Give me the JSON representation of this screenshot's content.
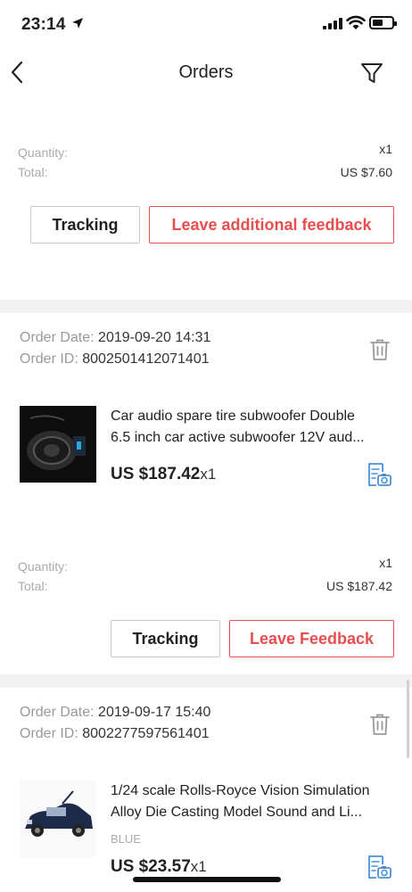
{
  "status": {
    "time": "23:14"
  },
  "nav": {
    "title": "Orders"
  },
  "order0": {
    "quantity_label": "Quantity:",
    "quantity_value": "x1",
    "total_label": "Total:",
    "total_value": "US $7.60",
    "tracking_label": "Tracking",
    "feedback_label": "Leave additional feedback"
  },
  "order1": {
    "date_label": "Order Date:",
    "date_value": "2019-09-20 14:31",
    "id_label": "Order ID:",
    "id_value": "8002501412071401",
    "title_line1": "Car audio spare tire subwoofer Double",
    "title_line2": "6.5 inch car active subwoofer 12V aud...",
    "price": "US $187.42",
    "qty": "x1",
    "quantity_label": "Quantity:",
    "quantity_value": "x1",
    "total_label": "Total:",
    "total_value": "US $187.42",
    "tracking_label": "Tracking",
    "feedback_label": "Leave Feedback"
  },
  "order2": {
    "date_label": "Order Date:",
    "date_value": "2019-09-17 15:40",
    "id_label": "Order ID:",
    "id_value": "8002277597561401",
    "title_line1": "1/24 scale Rolls-Royce Vision Simulation",
    "title_line2": "Alloy Die Casting Model Sound and Li...",
    "variant": "BLUE",
    "price": "US $23.57",
    "qty": "x1"
  },
  "colors": {
    "accent": "#e84e4e",
    "icon_blue": "#4a90d9",
    "background": "#f2f2f2"
  }
}
